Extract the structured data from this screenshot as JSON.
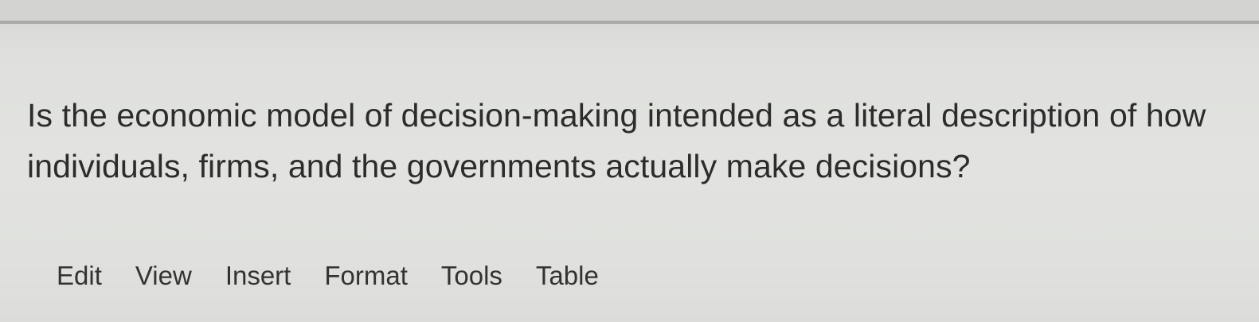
{
  "question": {
    "line1": "Is the economic model of decision-making intended as a literal description of how",
    "line2": "individuals, firms, and the governments actually make decisions?"
  },
  "editor_menu": {
    "items": [
      "Edit",
      "View",
      "Insert",
      "Format",
      "Tools",
      "Table"
    ]
  }
}
